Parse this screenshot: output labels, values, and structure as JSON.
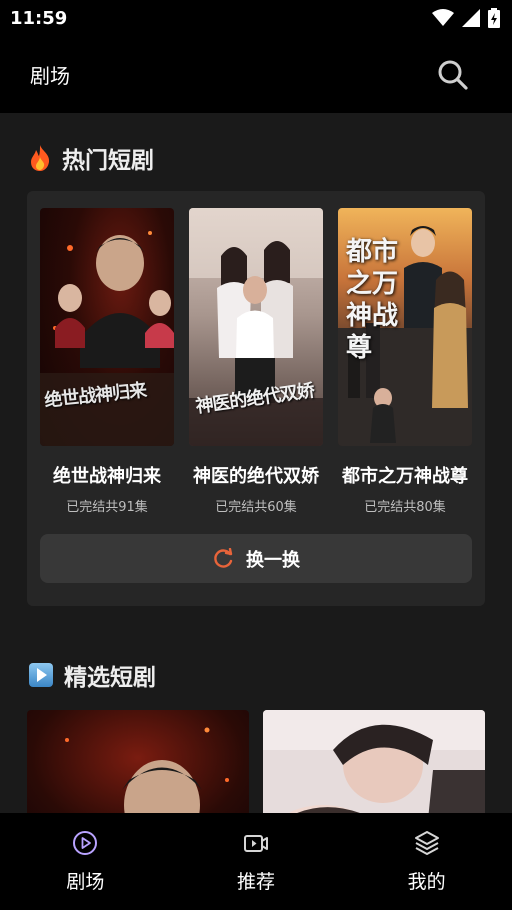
{
  "status_bar": {
    "time": "11:59"
  },
  "header": {
    "title": "剧场"
  },
  "hot_section": {
    "title": "热门短剧",
    "dramas": [
      {
        "title": "绝世战神归来",
        "subtitle": "已完结共91集",
        "poster_text": "绝世战神归来"
      },
      {
        "title": "神医的绝代双娇",
        "subtitle": "已完结共60集",
        "poster_text": "神医的绝代双娇"
      },
      {
        "title": "都市之万神战尊",
        "subtitle": "已完结共80集",
        "poster_text": "都市之万神战尊"
      }
    ],
    "refresh_label": "换一换"
  },
  "featured_section": {
    "title": "精选短剧"
  },
  "tabs": [
    {
      "label": "剧场",
      "icon": "play-circle-icon",
      "active": true
    },
    {
      "label": "推荐",
      "icon": "video-icon",
      "active": false
    },
    {
      "label": "我的",
      "icon": "layers-icon",
      "active": false
    }
  ],
  "colors": {
    "accent": "#e8643a",
    "active_tab_icon": "#b9a3ff"
  }
}
